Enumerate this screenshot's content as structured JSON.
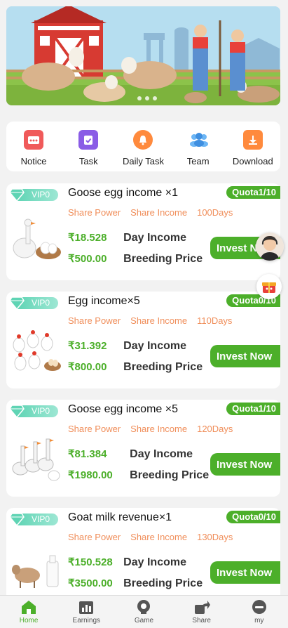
{
  "menu": [
    {
      "label": "Notice",
      "icon": "notice-icon",
      "color": "#f05a5a"
    },
    {
      "label": "Task",
      "icon": "task-icon",
      "color": "#8a5ce6"
    },
    {
      "label": "Daily Task",
      "icon": "bell-icon",
      "color": "#ff8a3d"
    },
    {
      "label": "Team",
      "icon": "team-icon",
      "color": "#4aa3f0"
    },
    {
      "label": "Download",
      "icon": "download-icon",
      "color": "#ff8a3d"
    }
  ],
  "products": [
    {
      "vip": "VIP0",
      "title": "Goose egg income ×1",
      "quota": "Quota1/10",
      "tags": [
        "Share Power",
        "Share Income",
        "100Days"
      ],
      "day_income": "₹18.528",
      "day_income_label": "Day Income",
      "price": "₹500.00",
      "price_label": "Breeding Price",
      "button": "Invest Now"
    },
    {
      "vip": "VIP0",
      "title": "Egg income×5",
      "quota": "Quota0/10",
      "tags": [
        "Share Power",
        "Share Income",
        "110Days"
      ],
      "day_income": "₹31.392",
      "day_income_label": "Day Income",
      "price": "₹800.00",
      "price_label": "Breeding Price",
      "button": "Invest Now"
    },
    {
      "vip": "VIP0",
      "title": "Goose egg income ×5",
      "quota": "Quota1/10",
      "tags": [
        "Share Power",
        "Share Income",
        "120Days"
      ],
      "day_income": "₹81.384",
      "day_income_label": "Day Income",
      "price": "₹1980.00",
      "price_label": "Breeding Price",
      "button": "Invest Now"
    },
    {
      "vip": "VIP0",
      "title": "Goat milk revenue×1",
      "quota": "Quota0/10",
      "tags": [
        "Share Power",
        "Share Income",
        "130Days"
      ],
      "day_income": "₹150.528",
      "day_income_label": "Day Income",
      "price": "₹3500.00",
      "price_label": "Breeding Price",
      "button": "Invest Now"
    }
  ],
  "nav": [
    {
      "label": "Home",
      "icon": "home-icon",
      "active": true
    },
    {
      "label": "Earnings",
      "icon": "earnings-icon",
      "active": false
    },
    {
      "label": "Game",
      "icon": "game-icon",
      "active": false
    },
    {
      "label": "Share",
      "icon": "share-icon",
      "active": false
    },
    {
      "label": "my",
      "icon": "profile-icon",
      "active": false
    }
  ],
  "colors": {
    "accent": "#4caf2a",
    "tag": "#f08e5a",
    "vip": "#5fd4b4"
  }
}
